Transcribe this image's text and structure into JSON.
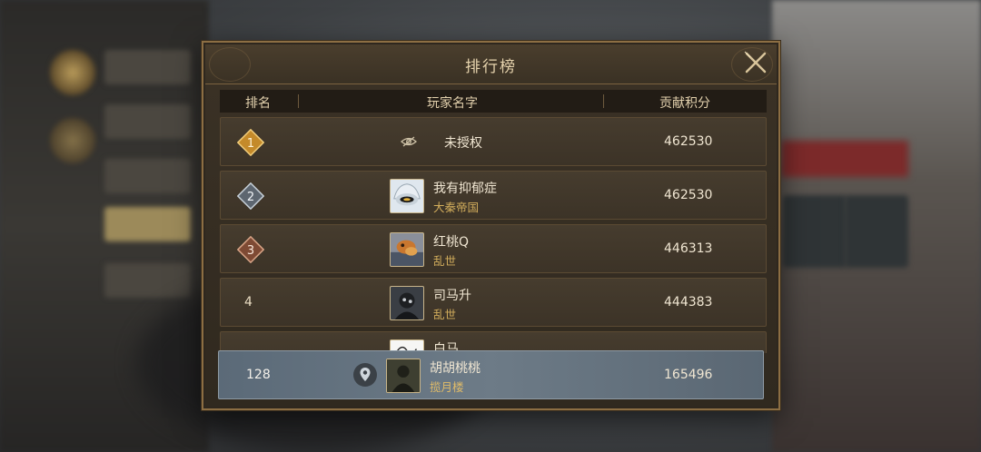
{
  "panel": {
    "title": "排行榜",
    "close_icon": "close-x-icon"
  },
  "columns": {
    "rank": "排名",
    "player": "玩家名字",
    "score": "贡献积分"
  },
  "rows": [
    {
      "rank": "1",
      "badge": "gold-diamond",
      "hidden": true,
      "name": "未授权",
      "guild": "",
      "score": "462530",
      "avatar": ""
    },
    {
      "rank": "2",
      "badge": "silver-diamond",
      "hidden": false,
      "name": "我有抑郁症",
      "guild": "大秦帝国",
      "score": "462530",
      "avatar": "cartoon-face"
    },
    {
      "rank": "3",
      "badge": "bronze-diamond",
      "hidden": false,
      "name": "红桃Q",
      "guild": "乱世",
      "score": "446313",
      "avatar": "orange-animal"
    },
    {
      "rank": "4",
      "badge": "",
      "hidden": false,
      "name": "司马升",
      "guild": "乱世",
      "score": "444383",
      "avatar": "dark-figure"
    },
    {
      "rank": "",
      "badge": "",
      "hidden": false,
      "name": "白马",
      "guild": "",
      "score": "",
      "avatar": "white-drawing"
    }
  ],
  "self_row": {
    "rank": "128",
    "name": "胡胡桃桃",
    "guild": "揽月楼",
    "score": "165496",
    "icon": "location-pin-icon"
  },
  "colors": {
    "accent_gold": "#d2ad5c",
    "panel_border": "#8c6e43",
    "self_row_bg": "#6d7b87"
  }
}
